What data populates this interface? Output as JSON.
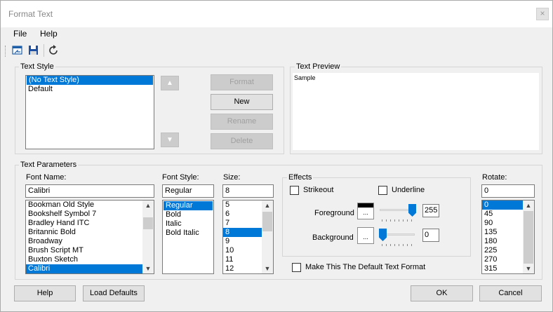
{
  "window": {
    "title": "Format Text",
    "close_glyph": "×"
  },
  "menu": {
    "file": "File",
    "help": "Help"
  },
  "toolbar": {
    "icons": [
      "open-icon",
      "save-icon",
      "refresh-icon"
    ]
  },
  "text_style": {
    "legend": "Text Style",
    "items": [
      "(No Text Style)",
      "Default"
    ],
    "selected_index": 0,
    "buttons": {
      "format": "Format",
      "new": "New",
      "rename": "Rename",
      "delete": "Delete"
    },
    "up_glyph": "▲",
    "down_glyph": "▼"
  },
  "text_preview": {
    "legend": "Text Preview",
    "sample": "Sample"
  },
  "text_parameters": {
    "legend": "Text Parameters",
    "font_name": {
      "label": "Font Name:",
      "value": "Calibri",
      "items": [
        "Bookman Old Style",
        "Bookshelf Symbol 7",
        "Bradley Hand ITC",
        "Britannic Bold",
        "Broadway",
        "Brush Script MT",
        "Buxton Sketch",
        "Calibri"
      ],
      "selected_index": 7
    },
    "font_style": {
      "label": "Font Style:",
      "value": "Regular",
      "items": [
        "Regular",
        "Bold",
        "Italic",
        "Bold Italic"
      ],
      "selected_index": 0
    },
    "size": {
      "label": "Size:",
      "value": "8",
      "items": [
        "5",
        "6",
        "7",
        "8",
        "9",
        "10",
        "11",
        "12"
      ],
      "selected_index": 3
    },
    "effects": {
      "legend": "Effects",
      "strikeout": "Strikeout",
      "underline": "Underline",
      "foreground_label": "Foreground",
      "foreground_value": "255",
      "background_label": "Background",
      "background_value": "0",
      "foreground_color": "#000000",
      "background_color": "#ffffff",
      "dots": "..."
    },
    "rotate": {
      "label": "Rotate:",
      "value": "0",
      "items": [
        "0",
        "45",
        "90",
        "135",
        "180",
        "225",
        "270",
        "315"
      ],
      "selected_index": 0
    },
    "make_default": "Make This The Default Text Format"
  },
  "bottom": {
    "help": "Help",
    "load_defaults": "Load Defaults",
    "ok": "OK",
    "cancel": "Cancel"
  }
}
